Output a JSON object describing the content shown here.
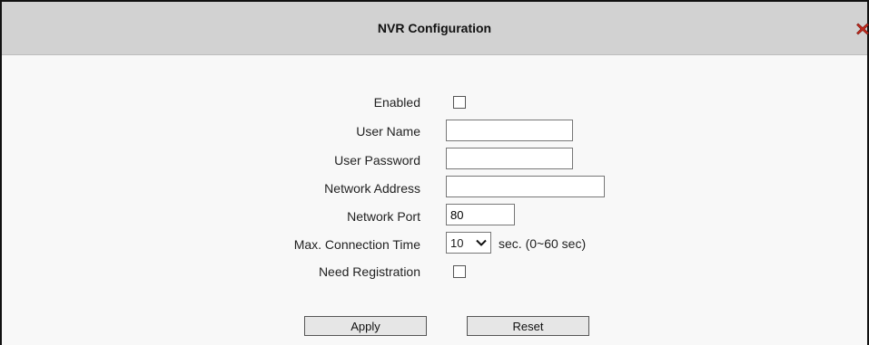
{
  "dialog": {
    "title": "NVR Configuration",
    "close_icon": "close-x-icon"
  },
  "form": {
    "enabled": {
      "label": "Enabled",
      "checked": false
    },
    "user_name": {
      "label": "User Name",
      "value": ""
    },
    "user_password": {
      "label": "User Password",
      "value": ""
    },
    "network_address": {
      "label": "Network Address",
      "value": ""
    },
    "network_port": {
      "label": "Network Port",
      "value": "80"
    },
    "max_connection_time": {
      "label": "Max. Connection Time",
      "selected": "10",
      "suffix": "sec. (0~60 sec)"
    },
    "need_registration": {
      "label": "Need Registration",
      "checked": false
    }
  },
  "buttons": {
    "apply_label": "Apply",
    "reset_label": "Reset"
  },
  "colors": {
    "titlebar": "#d2d2d2",
    "close_icon": "#c0281c"
  }
}
